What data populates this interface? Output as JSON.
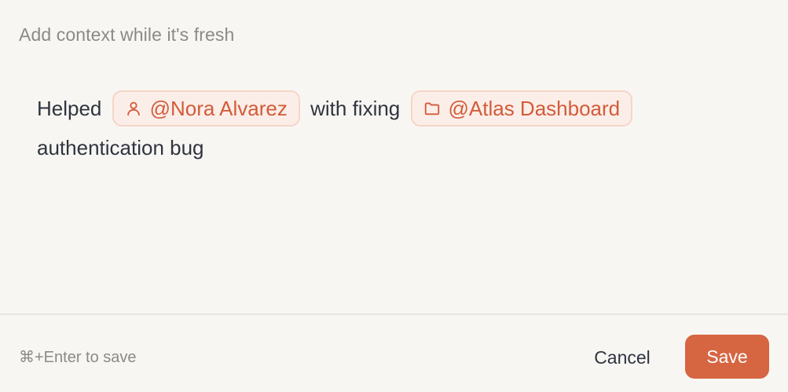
{
  "editor": {
    "placeholder": "Add context while it's fresh",
    "segments": {
      "text1": "Helped",
      "mention_person": "@Nora Alvarez",
      "text2": "with fixing",
      "mention_project": "@Atlas Dashboard",
      "text3": "authentication bug"
    },
    "icons": {
      "person": "person-icon",
      "folder": "folder-icon"
    }
  },
  "footer": {
    "hint": "⌘+Enter to save",
    "cancel_label": "Cancel",
    "save_label": "Save"
  },
  "colors": {
    "background": "#f8f6f2",
    "accent": "#d66542",
    "mention_text": "#d35b3a",
    "mention_bg": "#fbeee8",
    "mention_border": "#f6d5c9"
  }
}
